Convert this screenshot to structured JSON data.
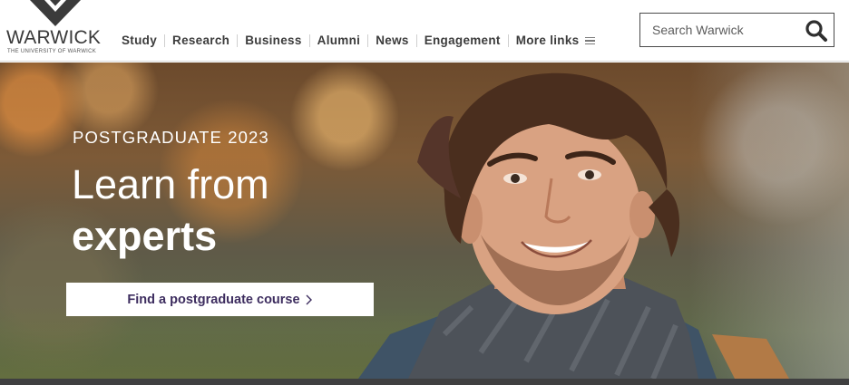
{
  "header": {
    "logo": {
      "wordmark": "WARWICK",
      "subtitle": "THE UNIVERSITY OF WARWICK"
    },
    "nav": [
      {
        "label": "Study"
      },
      {
        "label": "Research"
      },
      {
        "label": "Business"
      },
      {
        "label": "Alumni"
      },
      {
        "label": "News"
      },
      {
        "label": "Engagement"
      },
      {
        "label": "More links"
      }
    ],
    "search": {
      "placeholder": "Search Warwick",
      "value": "",
      "icon": "search-icon"
    }
  },
  "hero": {
    "eyebrow": "POSTGRADUATE 2023",
    "headline_line1": "Learn from",
    "headline_line2": "experts",
    "cta_label": "Find a postgraduate course",
    "cta_icon": "chevron-right-icon"
  },
  "colors": {
    "cta_text": "#3d2d5f",
    "nav_text": "#3c3c3c",
    "footer_bar": "#3f3f40"
  }
}
